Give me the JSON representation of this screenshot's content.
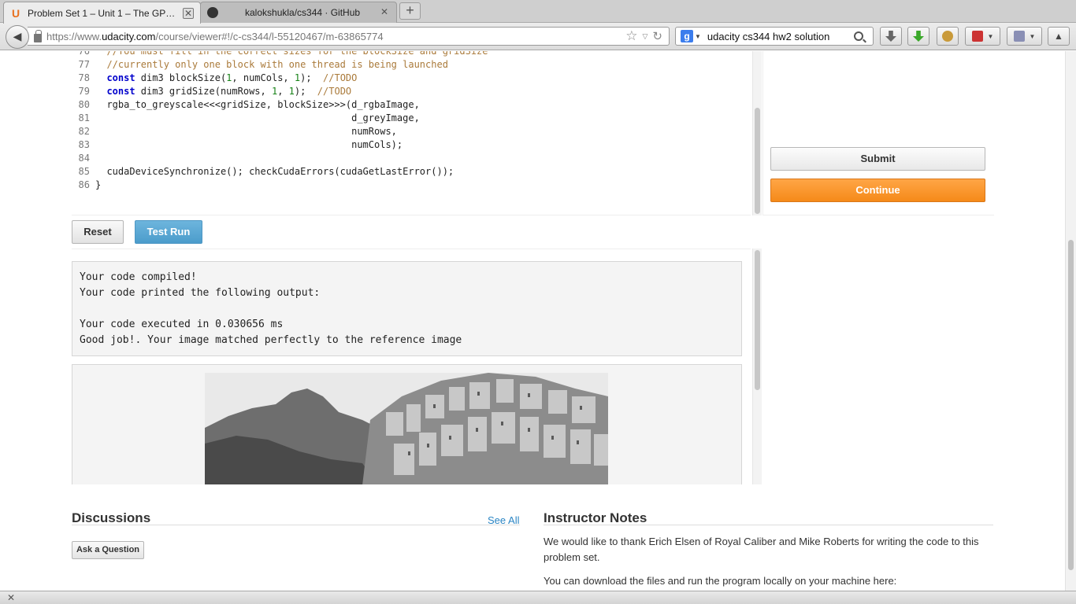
{
  "tabs": [
    {
      "title": "Problem Set 1 – Unit 1 – The GP…",
      "close": "✕",
      "active": true
    },
    {
      "title": "kalokshukla/cs344 · GitHub",
      "close": "✕",
      "active": false
    }
  ],
  "new_tab": "+",
  "nav": {
    "back": "◀",
    "url_host_prefix": "https://www.",
    "url_host": "udacity.com",
    "url_path": "/course/viewer#!/c-cs344/l-55120467/m-63865774",
    "bookmark_star": "☆",
    "reload": "↻",
    "search_engine_letter": "g",
    "search_query": "udacity cs344 hw2 solution"
  },
  "code": {
    "lines": [
      {
        "no": "76",
        "parts": [
          {
            "t": "cm",
            "v": "  //You must fill in the correct sizes for the blockSize and gridSize"
          }
        ]
      },
      {
        "no": "77",
        "parts": [
          {
            "t": "cm",
            "v": "  //currently only one block with one thread is being launched"
          }
        ]
      },
      {
        "no": "78",
        "parts": [
          {
            "t": "",
            "v": "  "
          },
          {
            "t": "kw",
            "v": "const"
          },
          {
            "t": "",
            "v": " dim3 blockSize("
          },
          {
            "t": "nm",
            "v": "1"
          },
          {
            "t": "",
            "v": ", numCols, "
          },
          {
            "t": "nm",
            "v": "1"
          },
          {
            "t": "",
            "v": ");  "
          },
          {
            "t": "cm",
            "v": "//TODO"
          }
        ]
      },
      {
        "no": "79",
        "parts": [
          {
            "t": "",
            "v": "  "
          },
          {
            "t": "kw",
            "v": "const"
          },
          {
            "t": "",
            "v": " dim3 gridSize(numRows, "
          },
          {
            "t": "nm",
            "v": "1"
          },
          {
            "t": "",
            "v": ", "
          },
          {
            "t": "nm",
            "v": "1"
          },
          {
            "t": "",
            "v": ");  "
          },
          {
            "t": "cm",
            "v": "//TODO"
          }
        ]
      },
      {
        "no": "80",
        "parts": [
          {
            "t": "",
            "v": "  rgba_to_greyscale<<<gridSize, blockSize>>>(d_rgbaImage,"
          }
        ]
      },
      {
        "no": "81",
        "parts": [
          {
            "t": "",
            "v": "                                             d_greyImage,"
          }
        ]
      },
      {
        "no": "82",
        "parts": [
          {
            "t": "",
            "v": "                                             numRows,"
          }
        ]
      },
      {
        "no": "83",
        "parts": [
          {
            "t": "",
            "v": "                                             numCols);"
          }
        ]
      },
      {
        "no": "84",
        "parts": [
          {
            "t": "",
            "v": ""
          }
        ]
      },
      {
        "no": "85",
        "parts": [
          {
            "t": "",
            "v": "  cudaDeviceSynchronize(); checkCudaErrors(cudaGetLastError());"
          }
        ]
      },
      {
        "no": "86",
        "parts": [
          {
            "t": "",
            "v": "}"
          }
        ]
      }
    ]
  },
  "buttons": {
    "submit": "Submit",
    "continue": "Continue",
    "reset": "Reset",
    "test_run": "Test Run",
    "ask": "Ask a Question"
  },
  "output": {
    "lines": [
      "Your code compiled!",
      "Your code printed the following output:",
      "",
      "Your code executed in 0.030656 ms",
      "Good job!. Your image matched perfectly to the reference image"
    ]
  },
  "discussions": {
    "title": "Discussions",
    "see_all": "See All"
  },
  "instructor_notes": {
    "title": "Instructor Notes",
    "p1": "We would like to thank Erich Elsen of Royal Caliber and Mike Roberts for writing the code to this problem set.",
    "p2": "You can download the files and run the program locally on your machine here:"
  },
  "addon_bar": {
    "close": "✕"
  },
  "colors": {
    "accent_orange": "#f58a19",
    "test_run_blue": "#4b9ccb",
    "link_blue": "#2a85c4"
  }
}
